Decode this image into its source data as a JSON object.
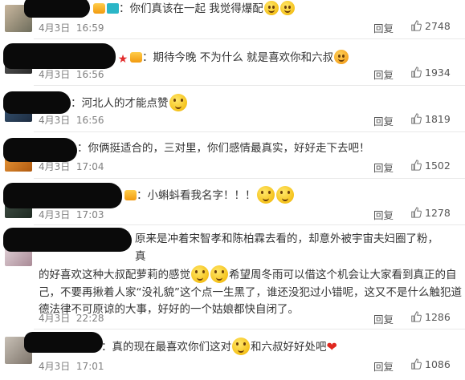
{
  "comments": [
    {
      "text_after": "：你们真该在一起 我觉得爆配",
      "date": "4月3日",
      "time": "16:59",
      "reply_label": "回复",
      "likes": "2748"
    },
    {
      "text_after": "：期待今晚 不为什么 就是喜欢你和六叔",
      "date": "4月3日",
      "time": "16:56",
      "reply_label": "回复",
      "likes": "1934"
    },
    {
      "text_after": "：河北人的才能点赞",
      "date": "4月3日",
      "time": "16:56",
      "reply_label": "回复",
      "likes": "1819"
    },
    {
      "text_after": "：你俩挺适合的，三对里，你们感情最真实，好好走下去吧！",
      "date": "4月3日",
      "time": "17:04",
      "reply_label": "回复",
      "likes": "1502"
    },
    {
      "text_after": "：小蝌蚪看我名字！！！",
      "date": "4月3日",
      "time": "17:03",
      "reply_label": "回复",
      "likes": "1278"
    },
    {
      "line1": "原来是冲着宋智孝和陈柏霖去看的，却意外被宇宙夫妇圈了粉，真",
      "line2_a": "的好喜欢这种大叔配萝莉的感觉",
      "line2_b": "希望周冬雨可以借这个机会让大家看到真正的自",
      "line3": "己，不要再揪着人家“没礼貌”这个点一生黑了，谁还没犯过小错呢，这又不是什么触犯道",
      "line4": "德法律不可原谅的大事，好好的一个姑娘都快自闭了。",
      "date": "4月3日",
      "time": "22:28",
      "reply_label": "回复",
      "likes": "1286"
    },
    {
      "text_a": "：真的现在最喜欢你们这对",
      "text_b": "和六叔好好处吧",
      "date": "4月3日",
      "time": "17:01",
      "reply_label": "回复",
      "likes": "1086"
    }
  ],
  "icons": {
    "thumb": "thumbs-up-icon",
    "emoji": "smiley-emoji-icon",
    "heart": "heart-emoji-icon"
  }
}
